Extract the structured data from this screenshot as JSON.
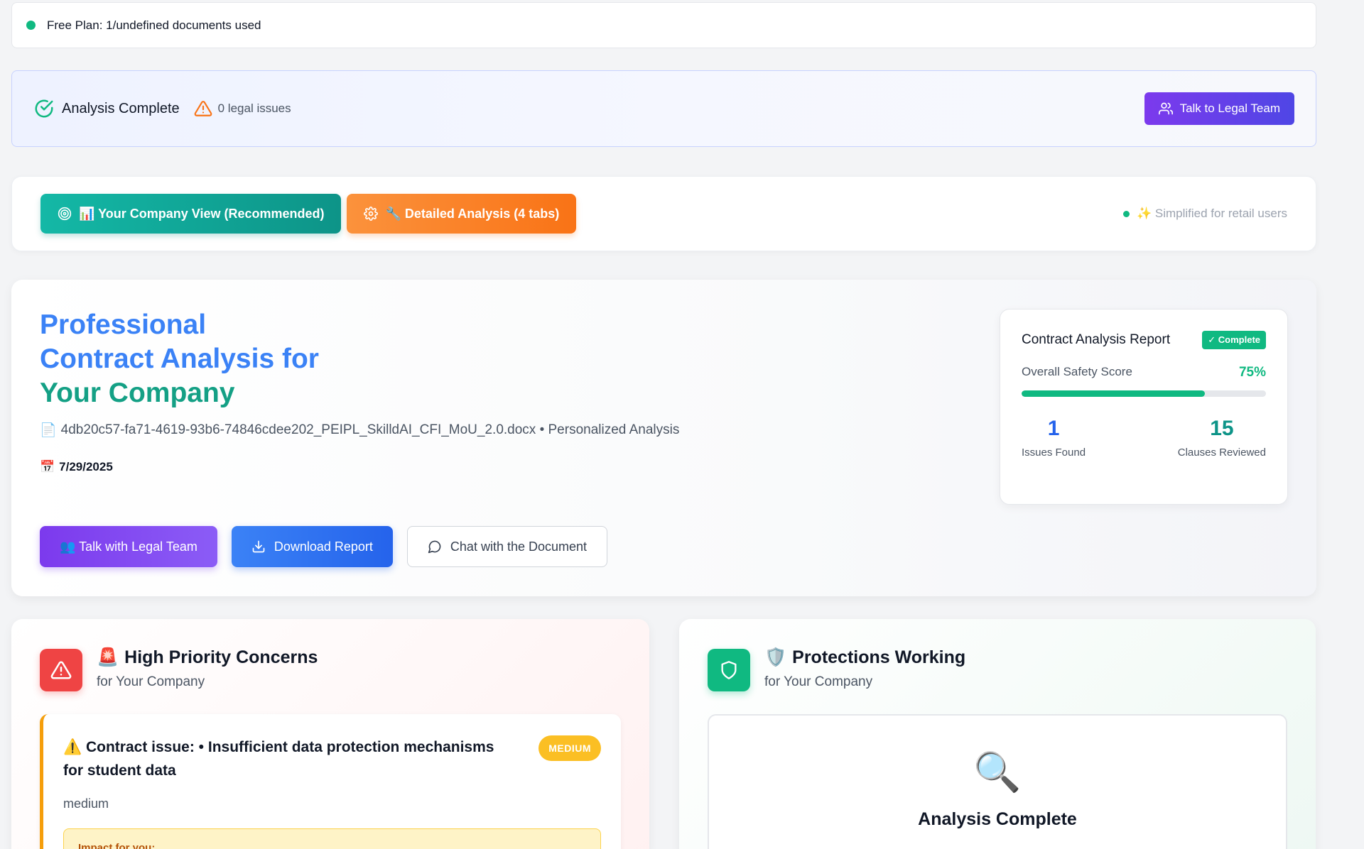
{
  "plan_bar": {
    "text": "Free Plan: 1/undefined documents used"
  },
  "status": {
    "title": "Analysis Complete",
    "issues": "0 legal issues",
    "legal_button": "Talk to Legal Team"
  },
  "view_toggle": {
    "company_view": "📊 Your Company View (Recommended)",
    "detailed": "🔧 Detailed Analysis (4 tabs)",
    "note": "✨ Simplified for retail users"
  },
  "hero": {
    "title_line1": "Professional",
    "title_line2": "Contract Analysis for",
    "title_line3": "Your Company",
    "file_icon": "📄",
    "file_text": "4db20c57-fa71-4619-93b6-74846cdee202_PEIPL_SkilldAI_CFI_MoU_2.0.docx • Personalized Analysis",
    "date_icon": "📅",
    "date": "7/29/2025",
    "actions": {
      "talk": "👥 Talk with Legal Team",
      "download": "Download Report",
      "chat": "Chat with the Document"
    }
  },
  "report": {
    "title": "Contract Analysis Report",
    "badge": "✓ Complete",
    "score_label": "Overall Safety Score",
    "score_value": "75%",
    "score_fraction": 0.75,
    "issues_num": "1",
    "issues_label": "Issues Found",
    "clauses_num": "15",
    "clauses_label": "Clauses Reviewed"
  },
  "concerns": {
    "emoji": "🚨",
    "title": "High Priority Concerns",
    "subtitle": "for Your Company",
    "issue": {
      "title": "⚠️ Contract issue: • Insufficient data protection mechanisms for student data",
      "badge": "MEDIUM",
      "severity": "medium",
      "impact_label": "Impact for you:"
    }
  },
  "protections": {
    "emoji": "🛡️",
    "title": "Protections Working",
    "subtitle": "for Your Company",
    "empty_icon": "🔍",
    "empty_title": "Analysis Complete"
  },
  "colors": {
    "accent_teal": "#14b8a6",
    "accent_orange": "#f97316",
    "accent_purple": "#7c3aed",
    "accent_blue": "#2563eb",
    "success": "#10b981",
    "danger": "#ef4444",
    "warning": "#f59e0b"
  },
  "icons": {
    "status_check": "check-circle-icon",
    "status_warning": "warning-triangle-icon",
    "legal_team": "users-icon",
    "company_view": "target-icon",
    "detailed": "gear-icon",
    "download": "download-icon",
    "chat": "chat-bubble-icon",
    "concerns": "alert-triangle-icon",
    "protections": "shield-icon"
  }
}
